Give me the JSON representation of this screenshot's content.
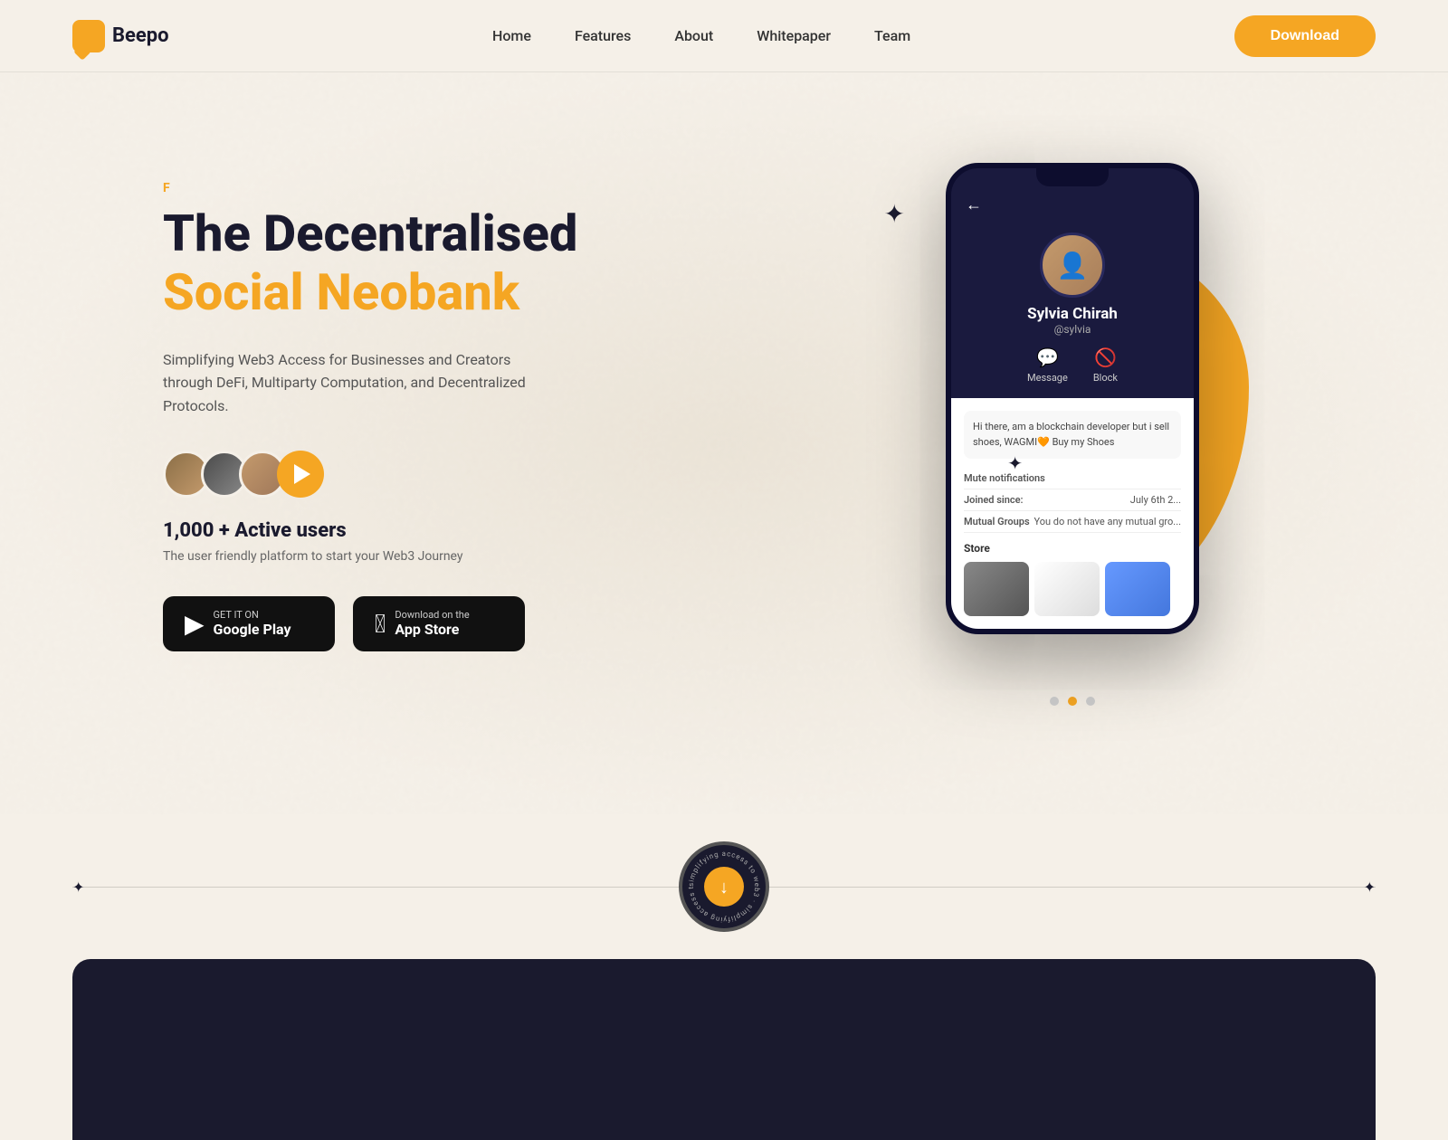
{
  "brand": {
    "name": "Beepo",
    "logo_text": "Beepo"
  },
  "nav": {
    "links": [
      {
        "label": "Home",
        "href": "#"
      },
      {
        "label": "Features",
        "href": "#"
      },
      {
        "label": "About",
        "href": "#"
      },
      {
        "label": "Whitepaper",
        "href": "#"
      },
      {
        "label": "Team",
        "href": "#"
      }
    ],
    "download_btn": "Download"
  },
  "hero": {
    "f_label": "F",
    "title_line1": "The Decentralised",
    "title_line2": "Social Neobank",
    "subtitle": "Simplifying Web3 Access for Businesses and Creators through DeFi, Multiparty Computation, and Decentralized Protocols.",
    "active_users_count": "1,000 + Active users",
    "active_users_sub": "The user friendly platform to start your Web3 Journey"
  },
  "store_buttons": {
    "google_play": {
      "top": "GET IT ON",
      "main": "Google Play"
    },
    "app_store": {
      "top": "Download on the",
      "main": "App Store"
    }
  },
  "phone_mock": {
    "profile_name": "Sylvia Chirah",
    "profile_handle": "@sylvia",
    "message_label": "Message",
    "block_label": "Block",
    "bio": "Hi there, am a blockchain developer but i sell shoes, WAGMI🧡 Buy my Shoes",
    "mute_label": "Mute notifications",
    "joined_label": "Joined since:",
    "joined_date": "July 6th 2...",
    "mutual_label": "Mutual Groups",
    "mutual_value": "You do not have any mutual gro...",
    "store_label": "Store"
  },
  "divider": {
    "badge_text": "simplifying access to web3",
    "arrow": "↓"
  },
  "carousel": {
    "dots": [
      {
        "active": false
      },
      {
        "active": true
      },
      {
        "active": false
      }
    ]
  }
}
